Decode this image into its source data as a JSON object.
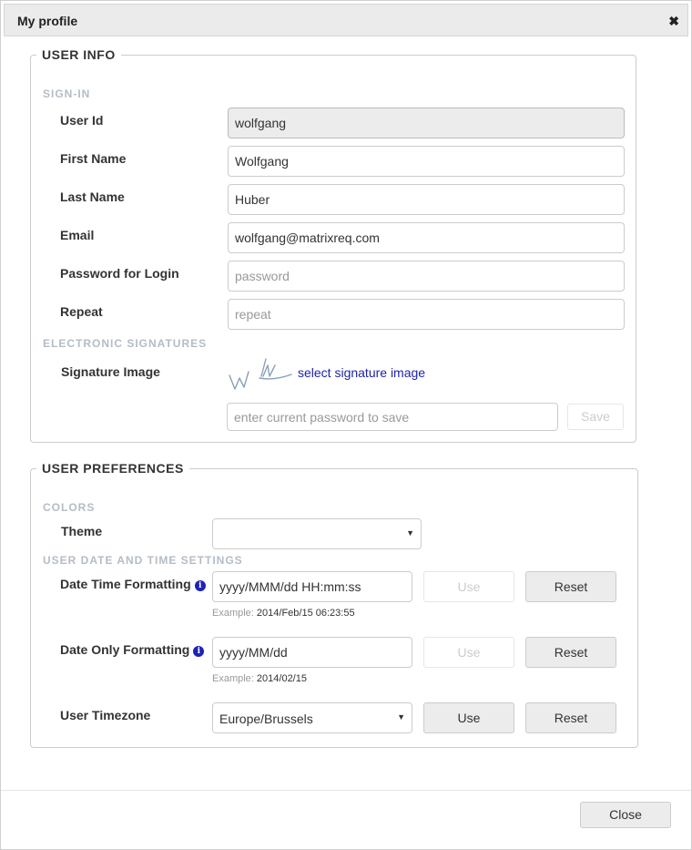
{
  "dialog": {
    "title": "My profile",
    "close_glyph": "✖"
  },
  "user_info": {
    "legend": "USER INFO",
    "signin_header": "SIGN-IN",
    "user_id": {
      "label": "User Id",
      "value": "wolfgang"
    },
    "first_name": {
      "label": "First Name",
      "value": "Wolfgang"
    },
    "last_name": {
      "label": "Last Name",
      "value": "Huber"
    },
    "email": {
      "label": "Email",
      "value": "wolfgang@matrixreq.com"
    },
    "password": {
      "label": "Password for Login",
      "placeholder": "password"
    },
    "repeat": {
      "label": "Repeat",
      "placeholder": "repeat"
    },
    "esig_header": "ELECTRONIC SIGNATURES",
    "signature": {
      "label": "Signature Image",
      "link": "select signature image"
    },
    "save_password_placeholder": "enter current password to save",
    "save_label": "Save"
  },
  "prefs": {
    "legend": "USER PREFERENCES",
    "colors_header": "COLORS",
    "theme": {
      "label": "Theme",
      "value": ""
    },
    "datetime_header": "USER DATE AND TIME SETTINGS",
    "date_time": {
      "label": "Date Time Formatting",
      "value": "yyyy/MMM/dd HH:mm:ss",
      "use": "Use",
      "reset": "Reset",
      "example_prefix": "Example:",
      "example": "2014/Feb/15 06:23:55"
    },
    "date_only": {
      "label": "Date Only Formatting",
      "value": "yyyy/MM/dd",
      "use": "Use",
      "reset": "Reset",
      "example_prefix": "Example:",
      "example": "2014/02/15"
    },
    "timezone": {
      "label": "User Timezone",
      "value": "Europe/Brussels",
      "use": "Use",
      "reset": "Reset"
    },
    "info_glyph": "i"
  },
  "footer": {
    "close_label": "Close"
  }
}
